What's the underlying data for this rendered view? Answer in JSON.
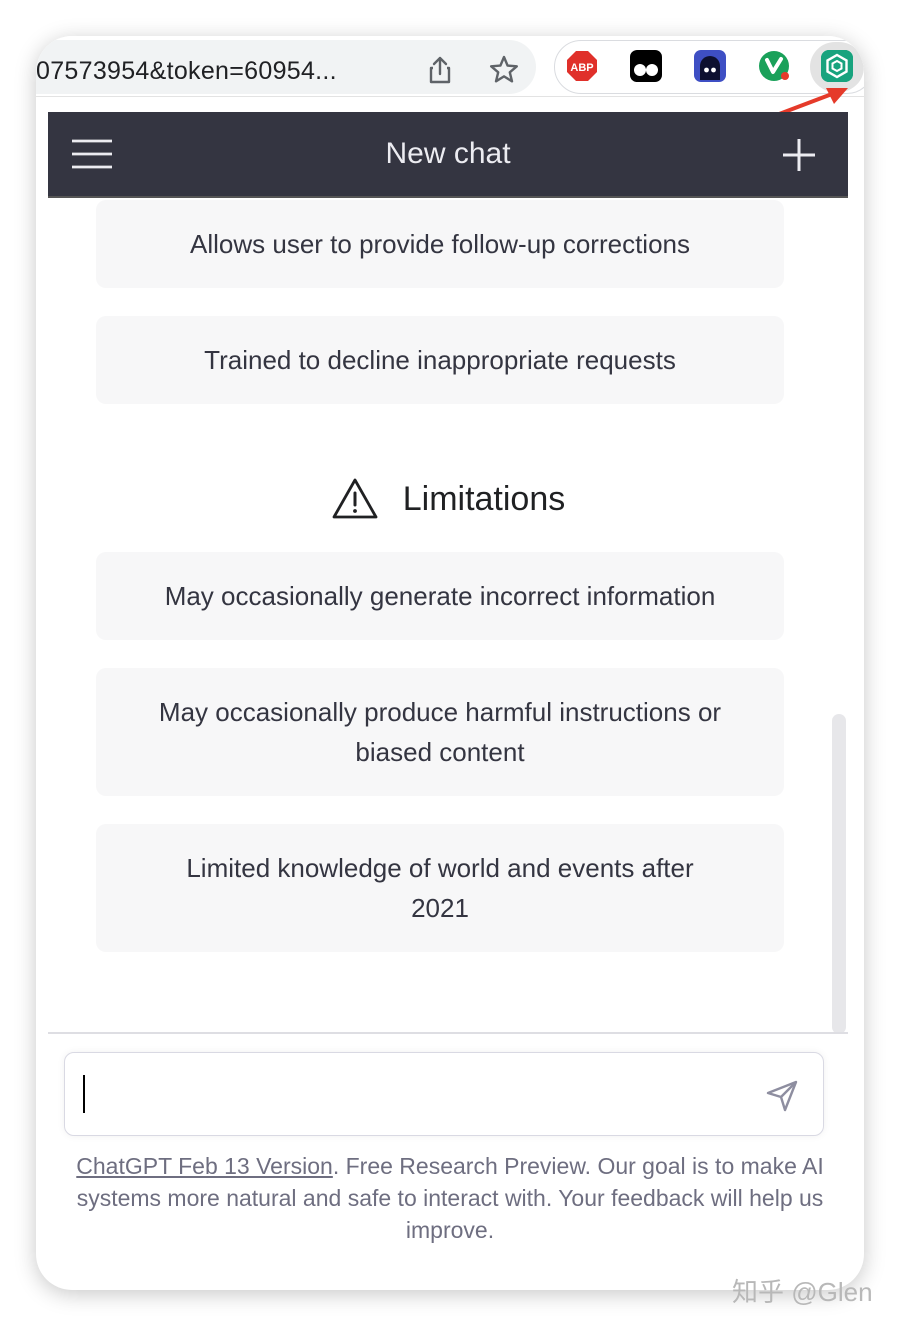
{
  "browser": {
    "url": "07573954&token=60954...",
    "extensions": [
      "abp-icon",
      "tampermonkey-icon",
      "ghost-icon",
      "v-icon",
      "chatgpt-extension-icon"
    ],
    "abp_label": "ABP"
  },
  "header": {
    "title": "New chat"
  },
  "capabilities": {
    "items": [
      "Allows user to provide follow-up corrections",
      "Trained to decline inappropriate requests"
    ]
  },
  "limitations": {
    "heading": "Limitations",
    "items": [
      "May occasionally generate incorrect information",
      "May occasionally produce harmful instructions or biased content",
      "Limited knowledge of world and events after 2021"
    ]
  },
  "composer": {
    "value": ""
  },
  "footer": {
    "link": "ChatGPT Feb 13 Version",
    "text": ". Free Research Preview. Our goal is to make AI systems more natural and safe to interact with. Your feedback will help us improve."
  },
  "watermark": "知乎 @Glen",
  "colors": {
    "header_bg": "#343541",
    "card_bg": "#f7f7f8",
    "accent_green": "#18a37e",
    "arrow_red": "#e53a2a"
  }
}
